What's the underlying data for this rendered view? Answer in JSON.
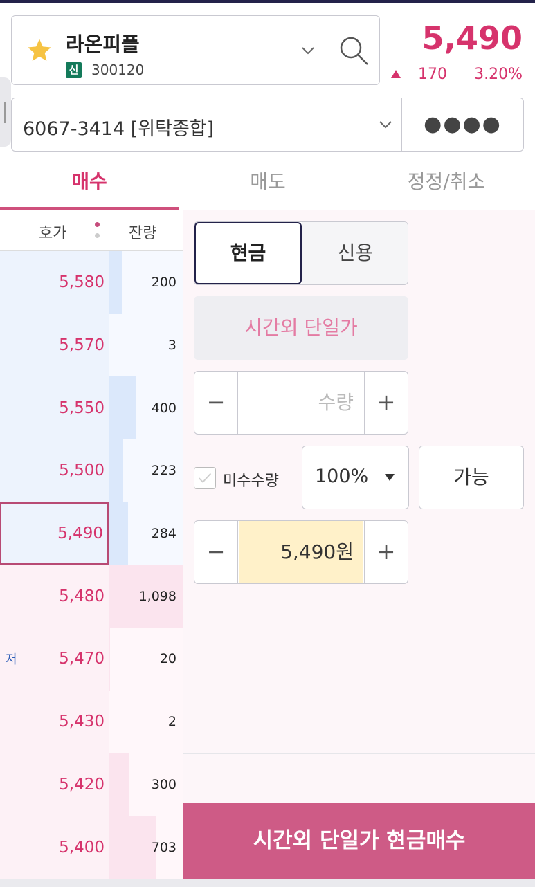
{
  "stock": {
    "name": "라온피플",
    "tag": "신",
    "code": "300120",
    "price": "5,490",
    "change": "170",
    "change_pct": "3.20%",
    "up_color": "#d6336c"
  },
  "account": {
    "label": "6067-3414 [위탁종합]",
    "password_mask": "●●●●"
  },
  "tabs": [
    {
      "label": "매수",
      "active": true
    },
    {
      "label": "매도",
      "active": false
    },
    {
      "label": "정정/취소",
      "active": false
    }
  ],
  "order_book": {
    "header_price": "호가",
    "header_qty": "잔량",
    "low_marker": "저",
    "asks": [
      {
        "price": "5,580",
        "qty": "200",
        "bar": 0.18
      },
      {
        "price": "5,570",
        "qty": "3",
        "bar": 0.0
      },
      {
        "price": "5,550",
        "qty": "400",
        "bar": 0.37
      },
      {
        "price": "5,500",
        "qty": "223",
        "bar": 0.2
      },
      {
        "price": "5,490",
        "qty": "284",
        "bar": 0.26
      }
    ],
    "bids": [
      {
        "price": "5,480",
        "qty": "1,098",
        "bar": 1.0
      },
      {
        "price": "5,470",
        "qty": "20",
        "bar": 0.02
      },
      {
        "price": "5,430",
        "qty": "2",
        "bar": 0.0
      },
      {
        "price": "5,420",
        "qty": "300",
        "bar": 0.27
      },
      {
        "price": "5,400",
        "qty": "703",
        "bar": 0.64
      }
    ]
  },
  "order_form": {
    "cash_label": "현금",
    "credit_label": "신용",
    "after_hours_label": "시간외 단일가",
    "qty_placeholder": "수량",
    "minus": "−",
    "plus": "+",
    "unfilled_label": "미수수량",
    "percent": "100%",
    "available_label": "가능",
    "price_value": "5,490원",
    "submit_label": "시간외 단일가 현금매수"
  },
  "icons": {
    "favorite": "star-icon",
    "dropdown": "chevron-down-icon",
    "search": "search-icon",
    "up": "triangle-up-icon",
    "caret": "caret-down-icon",
    "check": "check-icon"
  }
}
